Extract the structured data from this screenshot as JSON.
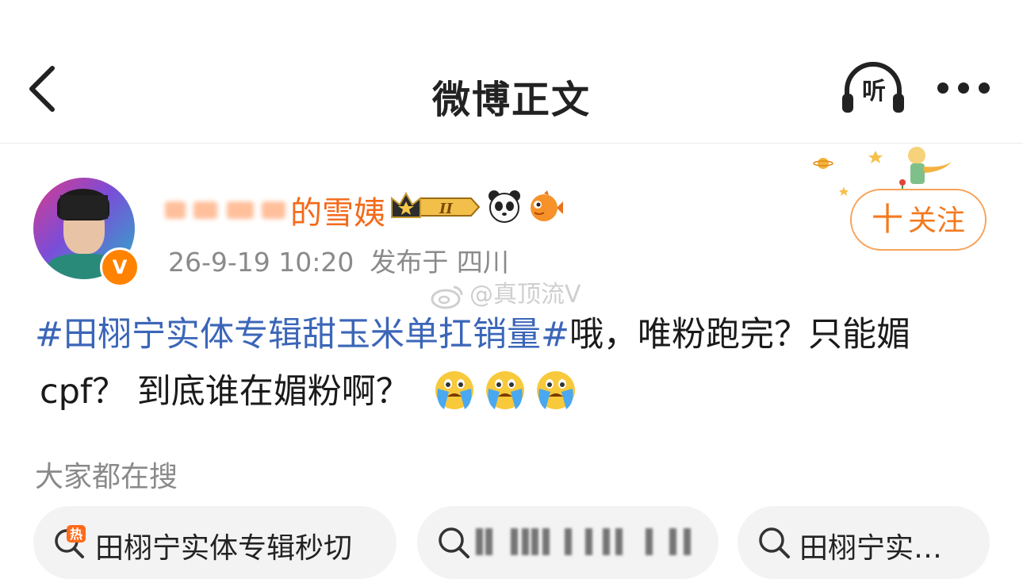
{
  "nav": {
    "title": "微博正文",
    "listen_label": "听"
  },
  "post": {
    "username_visible": "的雪姨",
    "vip_level": "II",
    "timestamp": "26-9-19 10:20",
    "location": "发布于 四川",
    "follow_label": "关注",
    "follow_plus": "十",
    "verify_badge": "V",
    "watermark": "@真顶流V",
    "topic": "#田栩宁实体专辑甜玉米单扛销量#",
    "text_line1": "哦，唯粉跑完？只能媚",
    "text_line2": "cpf？ 到底谁在媚粉啊？"
  },
  "hot_search": {
    "label": "大家都在搜",
    "chips": [
      {
        "text": "田栩宁实体专辑秒切",
        "icon": "hot-search-icon",
        "badge": "热"
      },
      {
        "text": "",
        "icon": "search-icon"
      },
      {
        "text": "田栩宁实…",
        "icon": "search-icon"
      }
    ]
  },
  "colors": {
    "topic": "#3b66b8",
    "username": "#f36a1a",
    "follow": "#f37a1f",
    "meta": "#8a8a8a"
  }
}
